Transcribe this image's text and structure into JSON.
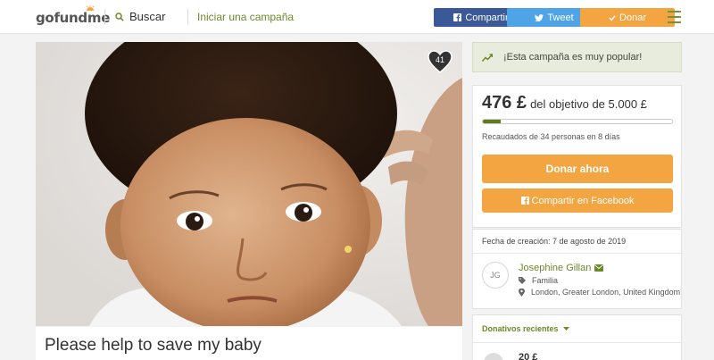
{
  "header": {
    "logo": "gofundme",
    "search_label": "Buscar",
    "start_campaign": "Iniciar una campaña",
    "share_label": "Compartir",
    "tweet_label": "Tweet",
    "donate_label": "Donar",
    "icons": {
      "search": "search-icon",
      "facebook": "facebook-icon",
      "twitter": "twitter-icon",
      "check": "check-icon",
      "menu": "hamburger-icon"
    }
  },
  "campaign": {
    "title": "Please help to save my baby",
    "hearts": "41",
    "image_alt": "baby photo"
  },
  "sidebar": {
    "popular_text": "¡Esta campaña es muy popular!",
    "raised_amount": "476 £",
    "goal_text": "del objetivo de 5.000 £",
    "progress_fraction": 0.0952,
    "raised_by": "Recaudados de 34 personas en 8 días",
    "donate_now": "Donar ahora",
    "share_facebook": "Compartir en Facebook",
    "created": "Fecha de creación: 7 de agosto de 2019",
    "organizer": {
      "initials": "JG",
      "name": "Josephine Gillan",
      "relation": "Familia",
      "location": "London, Greater London, United Kingdom"
    },
    "recent_donations_label": "Donativos recientes",
    "first_donation": "20 £"
  },
  "colors": {
    "accent": "#f3a541",
    "green": "#6a8a2a",
    "facebook": "#3b5998",
    "twitter": "#4fa4e8"
  }
}
